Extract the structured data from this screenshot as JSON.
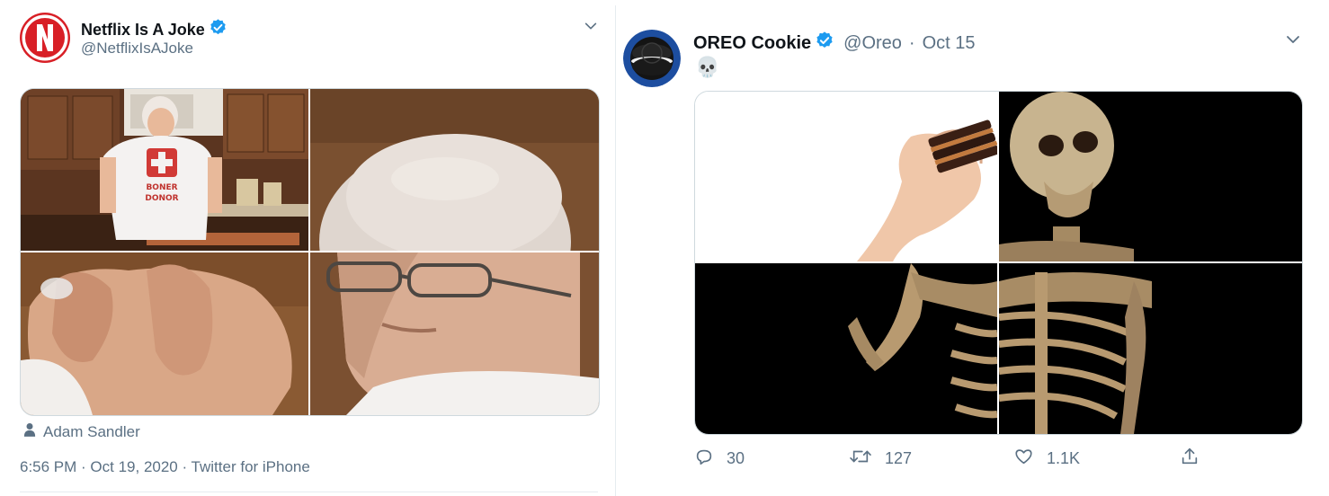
{
  "left_tweet": {
    "display_name": "Netflix Is A Joke",
    "handle": "@NetflixIsAJoke",
    "verified": true,
    "avatar_icon": "netflix-n-logo",
    "avatar_color": "#d81f26",
    "more_icon": "chevron-down-icon",
    "images": [
      {
        "name": "grandma-kitchen-photo",
        "shirt_text": "BONER DONOR"
      },
      {
        "name": "old-man-portrait-photo"
      },
      {
        "name": "hand-closeup-photo"
      },
      {
        "name": "old-man-glasses-photo"
      }
    ],
    "tagged_user_icon": "person-icon",
    "tagged_user": "Adam Sandler",
    "timestamp": "6:56 PM · Oct 19, 2020 · Twitter for iPhone"
  },
  "right_tweet": {
    "display_name": "OREO Cookie",
    "handle": "@Oreo",
    "separator": "·",
    "date": "Oct 15",
    "verified": true,
    "avatar_icon": "oreo-cookie-logo",
    "avatar_color": "#1d4ea0",
    "text": "💀",
    "more_icon": "chevron-down-icon",
    "images": [
      {
        "name": "hand-holding-cookies-photo"
      },
      {
        "name": "skull-photo"
      },
      {
        "name": "skeleton-arm-photo"
      },
      {
        "name": "skeleton-ribcage-photo"
      }
    ],
    "actions": {
      "reply": {
        "icon": "reply-icon",
        "count": "30"
      },
      "retweet": {
        "icon": "retweet-icon",
        "count": "127"
      },
      "like": {
        "icon": "heart-icon",
        "count": "1.1K"
      },
      "share": {
        "icon": "share-icon"
      }
    }
  },
  "colors": {
    "verified_blue": "#1d9bf0",
    "muted_text": "#5b7083",
    "divider": "#e6ecf0"
  }
}
